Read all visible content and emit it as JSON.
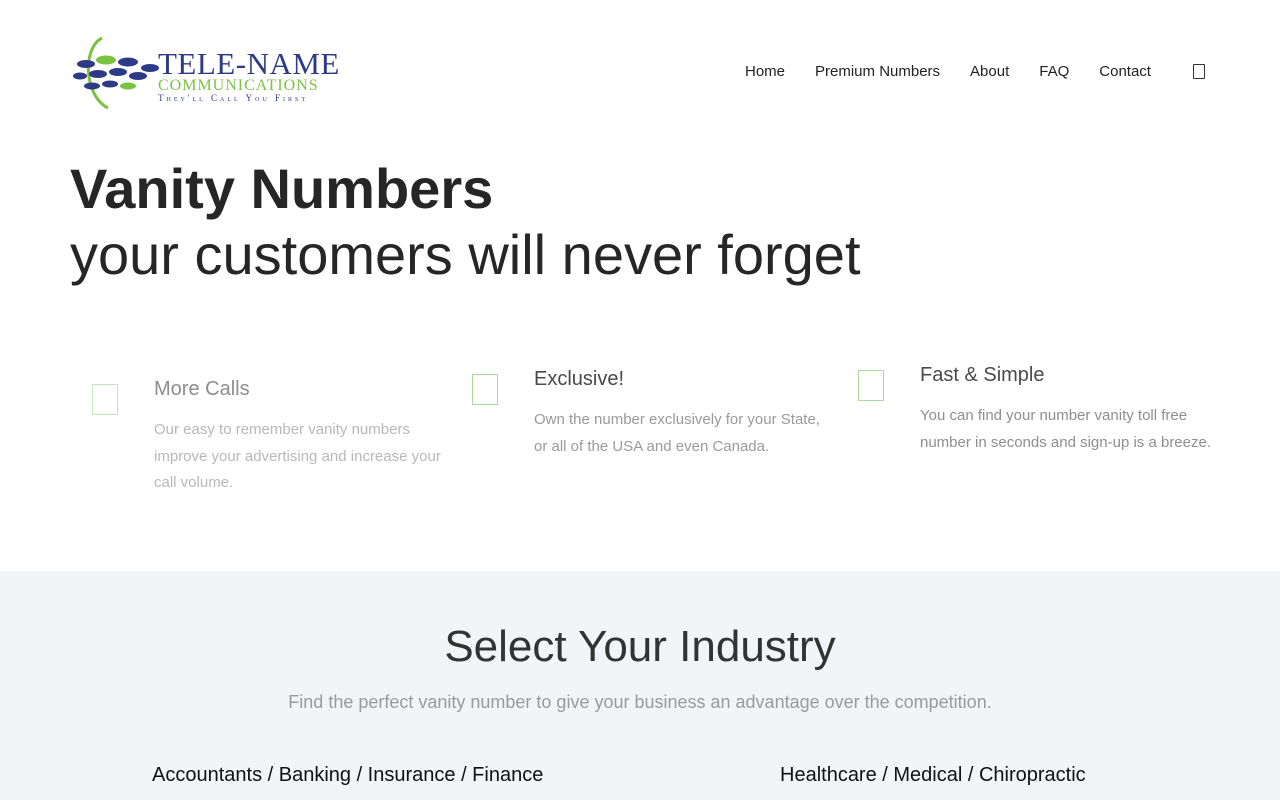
{
  "brand": {
    "title": "TELE-NAME",
    "subtitle": "COMMUNICATIONS",
    "tagline": "They'll Call You First",
    "colors": {
      "navy": "#2d3a86",
      "green": "#7cc242"
    }
  },
  "nav": {
    "items": [
      "Home",
      "Premium Numbers",
      "About",
      "FAQ",
      "Contact"
    ],
    "cart_icon": "cart-icon"
  },
  "hero": {
    "title": "Vanity Numbers",
    "subtitle": "your customers will never forget"
  },
  "features": [
    {
      "icon": "feature-icon",
      "title": "More Calls",
      "text": "Our easy to remember vanity numbers improve your advertising and increase your call volume."
    },
    {
      "icon": "feature-icon",
      "title": "Exclusive!",
      "text": "Own the number exclusively for your State, or all of the USA and even Canada."
    },
    {
      "icon": "feature-icon",
      "title": "Fast & Simple",
      "text": "You can find your number vanity toll free number in seconds and sign-up is a breeze."
    }
  ],
  "industry": {
    "title": "Select Your Industry",
    "lead": "Find the perfect vanity number to give your business an advantage over the competition.",
    "categories": [
      "Accountants / Banking / Insurance / Finance",
      "Healthcare / Medical / Chiropractic"
    ],
    "background": "#f3f4f7"
  }
}
